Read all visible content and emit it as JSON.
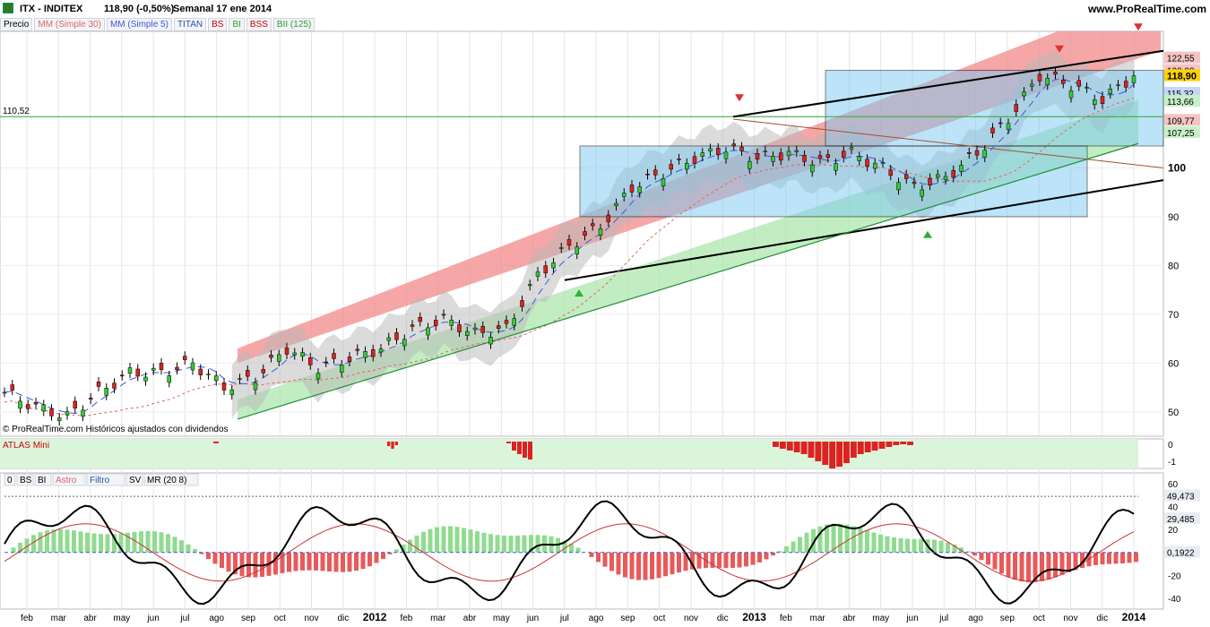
{
  "header": {
    "symbol": "ITX - INDITEX",
    "price": "118,90 (-0,50%)",
    "period": "Semanal  17 ene 2014",
    "site": "www.ProRealTime.com"
  },
  "legend_top": [
    "Precio",
    "MM (Simple 30)",
    "MM (Simple 5)",
    "TITAN",
    "BS",
    "BI",
    "BSS",
    "BII (125)"
  ],
  "legend_top_colors": [
    "#000000",
    "#e06666",
    "#3b5bd9",
    "#2255aa",
    "#cc0000",
    "#2e9e2e",
    "#cc0000",
    "#2e9e2e"
  ],
  "price_labels": {
    "hline": "110,52",
    "right": [
      "122,55",
      "120,00",
      "118,90",
      "115,32",
      "113,66",
      "109,77",
      "107,25"
    ],
    "current": "118,90"
  },
  "watermark": "© ProRealTime.com  Históricos ajustados con dividendos",
  "atlas": {
    "title": "ATLAS Mini",
    "y_labels": [
      "0",
      "-1"
    ]
  },
  "lower": {
    "tags": [
      "0",
      "BS",
      "BI",
      "Astro",
      "Filtro",
      "SV",
      "MR (20 8)"
    ],
    "y_labels": [
      "60",
      "40",
      "20",
      "0",
      "-20",
      "-40"
    ],
    "right": [
      "49,473",
      "29,485",
      "0,1922"
    ]
  },
  "x_labels": [
    "feb",
    "mar",
    "abr",
    "may",
    "jun",
    "jul",
    "ago",
    "sep",
    "oct",
    "nov",
    "dic",
    "2012",
    "feb",
    "mar",
    "abr",
    "may",
    "jun",
    "jul",
    "ago",
    "sep",
    "oct",
    "nov",
    "dic",
    "2013",
    "feb",
    "mar",
    "abr",
    "may",
    "jun",
    "jul",
    "ago",
    "sep",
    "oct",
    "nov",
    "dic",
    "2014"
  ],
  "chart_data": {
    "type": "line",
    "title": "ITX - INDITEX",
    "ylim": [
      45,
      128
    ],
    "y_ticks": [
      50,
      60,
      70,
      80,
      90,
      100
    ],
    "x": [
      "2011-01",
      "2011-02",
      "2011-03",
      "2011-04",
      "2011-05",
      "2011-06",
      "2011-07",
      "2011-08",
      "2011-09",
      "2011-10",
      "2011-11",
      "2011-12",
      "2012-01",
      "2012-02",
      "2012-03",
      "2012-04",
      "2012-05",
      "2012-06",
      "2012-07",
      "2012-08",
      "2012-09",
      "2012-10",
      "2012-11",
      "2012-12",
      "2013-01",
      "2013-02",
      "2013-03",
      "2013-04",
      "2013-05",
      "2013-06",
      "2013-07",
      "2013-08",
      "2013-09",
      "2013-10",
      "2013-11",
      "2013-12",
      "2014-01"
    ],
    "series": [
      {
        "name": "Precio",
        "values": [
          54,
          51,
          49,
          54,
          58,
          58,
          60,
          55,
          57,
          63,
          59,
          61,
          63,
          67,
          69,
          66,
          67,
          78,
          84,
          88,
          96,
          99,
          102,
          104,
          102,
          103,
          101,
          103,
          100,
          96,
          98,
          103,
          110,
          119,
          117,
          114,
          118.9
        ]
      }
    ]
  }
}
